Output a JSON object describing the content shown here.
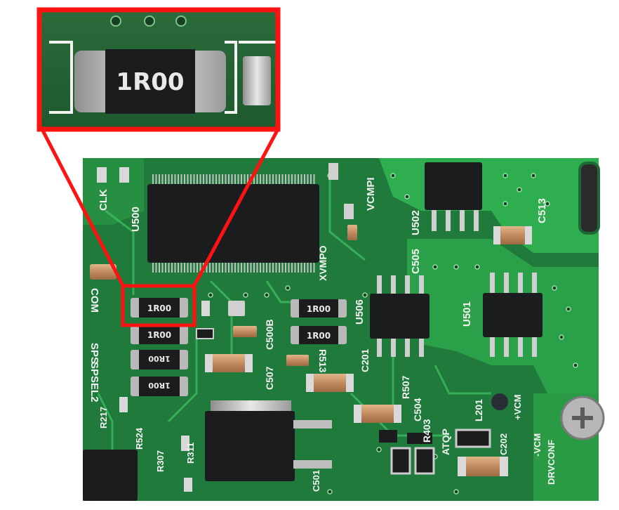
{
  "zoom_marking": "1R00",
  "resistor_markings": [
    "1R00",
    "1R00",
    "1R00",
    "1R00",
    "1R00",
    "1R00"
  ],
  "pcb_labels": {
    "u500": "U500",
    "u502": "U502",
    "u506": "U506",
    "u501": "U501",
    "c513": "C513",
    "c505": "C505",
    "vcmpi": "VCMPI",
    "xvmpo": "XVMPO",
    "com": "COM",
    "sps": "SPS",
    "spsel2": "SPSEL2",
    "c507": "C507",
    "c500b": "C500B",
    "r513": "R513",
    "c201": "C201",
    "r507": "R507",
    "c504": "C504",
    "r403": "R403",
    "atqp": "ATQP",
    "l201": "L201",
    "vcm_plus": "+VCM",
    "vcm_minus": "-VCM",
    "drvconf": "DRVCONF",
    "c202": "C202",
    "r217": "R217",
    "r524": "R524",
    "r307": "R307",
    "r311": "R311",
    "c501": "C501",
    "clk": "CLK"
  },
  "colors": {
    "highlight": "#ff1212",
    "pcb_green": "#1f7a3c",
    "pcb_bright": "#2fae4f",
    "silkscreen": "#f2f2f2",
    "chip_body": "#1b1c1e",
    "pin_metal": "#c9c9c9"
  }
}
